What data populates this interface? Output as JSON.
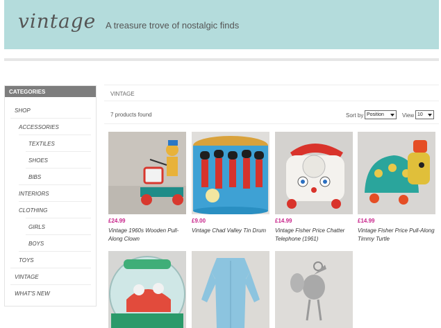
{
  "header": {
    "logo": "vintage",
    "tagline": "A treasure trove of nostalgic finds"
  },
  "sidebar": {
    "heading": "CATEGORIES",
    "items": [
      {
        "label": "SHOP"
      },
      {
        "label": "ACCESSORIES"
      },
      {
        "label": "TEXTILES"
      },
      {
        "label": "SHOES"
      },
      {
        "label": "BIBS"
      },
      {
        "label": "INTERIORS"
      },
      {
        "label": "CLOTHING"
      },
      {
        "label": "GIRLS"
      },
      {
        "label": "BOYS"
      },
      {
        "label": "TOYS"
      },
      {
        "label": "VINTAGE"
      },
      {
        "label": "WHAT'S NEW"
      }
    ]
  },
  "main": {
    "breadcrumb": "VINTAGE",
    "products_found": "7 products found",
    "sort_label": "Sort by",
    "sort_value": "Position",
    "view_label": "View",
    "view_value": "10"
  },
  "products": [
    {
      "price": "£24.99",
      "name": "Vintage 1960s Wooden Pull-Along Clown"
    },
    {
      "price": "£9.00",
      "name": "Vintage Chad Valley Tin Drum"
    },
    {
      "price": "£14.99",
      "name": "Vintage Fisher Price Chatter Telephone (1961)"
    },
    {
      "price": "£14.99",
      "name": "Vintage Fisher Price Pull-Along Timmy Turtle"
    },
    {
      "price": "",
      "name": ""
    },
    {
      "price": "",
      "name": ""
    },
    {
      "price": "",
      "name": ""
    }
  ],
  "colors": {
    "header_bg": "#b4dcdc",
    "price": "#c8238a",
    "sidebar_head": "#7d7d7d"
  }
}
